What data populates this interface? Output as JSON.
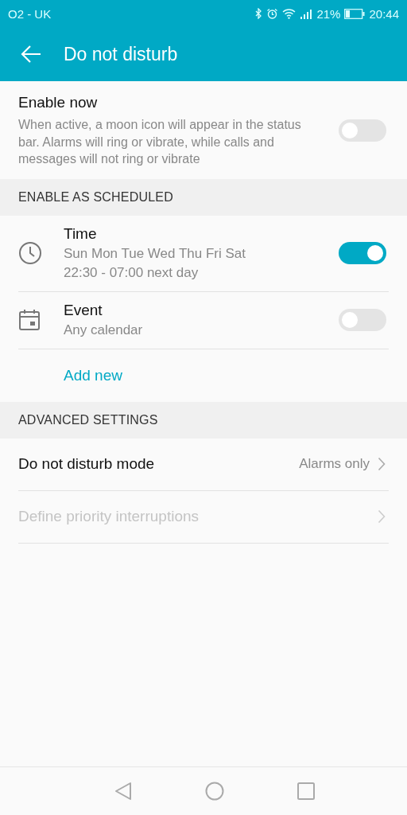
{
  "status_bar": {
    "carrier": "O2 - UK",
    "battery_percent": "21%",
    "time": "20:44"
  },
  "toolbar": {
    "title": "Do not disturb"
  },
  "enable_now": {
    "title": "Enable now",
    "description": "When active, a moon icon will appear in the status bar. Alarms will ring or vibrate, while calls and messages will not ring or vibrate",
    "on": false
  },
  "schedule": {
    "header": "ENABLE AS SCHEDULED",
    "items": [
      {
        "kind": "clock",
        "title": "Time",
        "lines": [
          "Sun Mon Tue Wed Thu Fri Sat",
          "22:30 - 07:00 next day"
        ],
        "on": true
      },
      {
        "kind": "calendar",
        "title": "Event",
        "lines": [
          "Any calendar"
        ],
        "on": false
      }
    ],
    "add_new": "Add new"
  },
  "advanced": {
    "header": "ADVANCED SETTINGS",
    "rows": [
      {
        "label": "Do not disturb mode",
        "value": "Alarms only",
        "disabled": false
      },
      {
        "label": "Define priority interruptions",
        "disabled": true
      }
    ]
  }
}
